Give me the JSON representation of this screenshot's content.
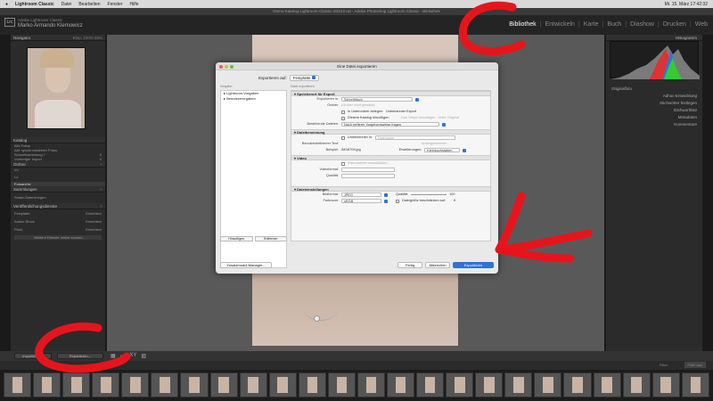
{
  "menubar": {
    "app": "Lightroom Classic",
    "items": [
      "Datei",
      "Bearbeiten",
      "Fenster",
      "Hilfe"
    ],
    "clock": "Mi. 15. März  17:42:32"
  },
  "window_title": "Demo-Katalog-Lightroom-Classic-2023.lrcat - Adobe Photoshop Lightroom Classic - Bibliothek",
  "identity": {
    "logo": "Lrc",
    "line1": "Adobe Lightroom Classic",
    "line2": "Marko Armando Klemowicz"
  },
  "modules": [
    "Bibliothek",
    "Entwickeln",
    "Karte",
    "Buch",
    "Diashow",
    "Drucken",
    "Web"
  ],
  "active_module": "Bibliothek",
  "left_panel": {
    "navigator": {
      "title": "Navigator",
      "opts": "Einp. 100% 50%"
    },
    "catalog": {
      "title": "Katalog",
      "rows": [
        {
          "label": "Alle Fotos",
          "count": ""
        },
        {
          "label": "Alle synchronisierten Fotos",
          "count": ""
        },
        {
          "label": "Schnellsammlung +",
          "count": "0"
        },
        {
          "label": "Vorheriger Import",
          "count": "0"
        }
      ]
    },
    "folders": {
      "title": "Ordner",
      "rows": [
        {
          "label": "Vo",
          "count": ""
        },
        {
          "label": "Lo",
          "count": ""
        },
        {
          "label": "Fotoarchiv",
          "count": ""
        }
      ]
    },
    "collections": {
      "title": "Sammlungen",
      "rows": [
        {
          "label": "Smart-Sammlungen",
          "count": ""
        }
      ]
    },
    "publish": {
      "title": "Veröffentlichungsdienste",
      "rows": [
        {
          "label": "Festplatte",
          "count": "Einrichten"
        },
        {
          "label": "Adobe Stock",
          "count": "Einrichten"
        },
        {
          "label": "Flickr",
          "count": "Einrichten"
        }
      ],
      "more": "Weitere Dienste online suchen..."
    }
  },
  "right_panel": {
    "histogram": "Histogramm",
    "rows": [
      "Adhoc-Entwicklung",
      "Stichwörter festlegen",
      "Stichwortliste",
      "Metadaten",
      "Kommentare"
    ],
    "original": "Originalfoto"
  },
  "bottom": {
    "import": "Importieren...",
    "export": "Exportieren...",
    "filter": "Filter:",
    "filter_value": "Filter aus"
  },
  "dialog": {
    "title": "Eine Datei exportieren",
    "export_to_label": "Exportieren auf:",
    "export_to_value": "Festplatte",
    "preset_header": "Vorgabe:",
    "settings_header": "Datei exportieren",
    "presets": [
      "Lightroom-Vorgaben",
      "Benutzervorgaben"
    ],
    "add": "Hinzufügen",
    "remove": "Entfernen",
    "sections": {
      "location": {
        "title": "Speicherort für Export",
        "export_to": "Exportieren in:",
        "export_to_value": "Schreibtisch",
        "folder": "Ordner:",
        "folder_value": "(Ordner nicht gewählt)",
        "subfolder": "In Unterordner ablegen:",
        "subfolder_value": "Unbenannter Export",
        "add_catalog": "Diesem Katalog hinzufügen",
        "stack": "Zum Stapel hinzufügen",
        "stack_pos": "Unter Original",
        "existing": "Bestehende Dateien:",
        "existing_value": "Nach weiterer Vorgehensweise fragen"
      },
      "naming": {
        "title": "Dateibenennung",
        "rename": "Umbenennen in:",
        "rename_value": "Dateiname",
        "custom": "Benutzerdefinierter Text:",
        "start": "Anfangsnummer:",
        "example": "Beispiel:",
        "example_value": "IMG8709.jpg",
        "ext": "Erweiterungen:",
        "ext_value": "Kleinbuchstaben"
      },
      "video": {
        "title": "Video",
        "include": "Videodateien einschließen:",
        "format": "Videoformat:",
        "quality": "Qualität:"
      },
      "file": {
        "title": "Dateieinstellungen",
        "format": "Bildformat:",
        "format_value": "JPEG",
        "quality": "Qualität:",
        "quality_value": "100",
        "colorspace": "Farbraum:",
        "colorspace_value": "sRGB",
        "limit": "Dateigröße beschränken auf:",
        "limit_value": "K"
      }
    },
    "plugin_manager": "Zusatzmodul-Manager...",
    "done": "Fertig",
    "cancel": "Abbrechen",
    "export": "Exportieren"
  },
  "colors": {
    "annotation": "#e8141b",
    "accent": "#2f73d8"
  }
}
